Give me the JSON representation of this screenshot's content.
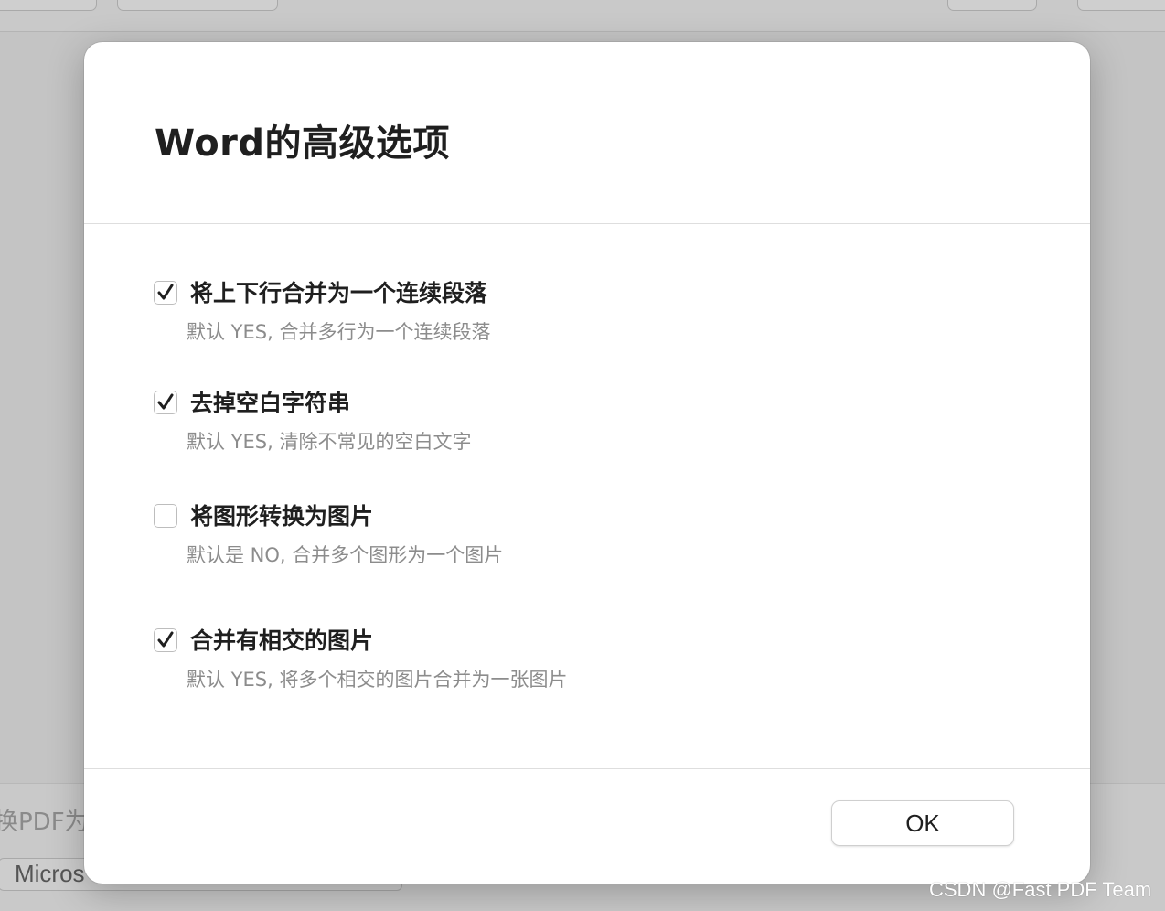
{
  "background_app": {
    "footer_text": "换PDF为",
    "format_select": "Micros"
  },
  "dialog": {
    "title": "Word的高级选项",
    "options": [
      {
        "label": "将上下行合并为一个连续段落",
        "description": "默认 YES, 合并多行为一个连续段落",
        "checked": true
      },
      {
        "label": "去掉空白字符串",
        "description": "默认 YES, 清除不常见的空白文字",
        "checked": true
      },
      {
        "label": "将图形转换为图片",
        "description": "默认是 NO, 合并多个图形为一个图片",
        "checked": false
      },
      {
        "label": "合并有相交的图片",
        "description": "默认 YES, 将多个相交的图片合并为一张图片",
        "checked": true
      }
    ],
    "ok_label": "OK"
  },
  "watermark": "CSDN @Fast PDF Team",
  "colors": {
    "overlay": "#c4c4c4",
    "dialog_bg": "#ffffff",
    "title_text": "#1f1f1f",
    "description_text": "#8c8c8c",
    "checkmark": "#1f1f1f"
  }
}
